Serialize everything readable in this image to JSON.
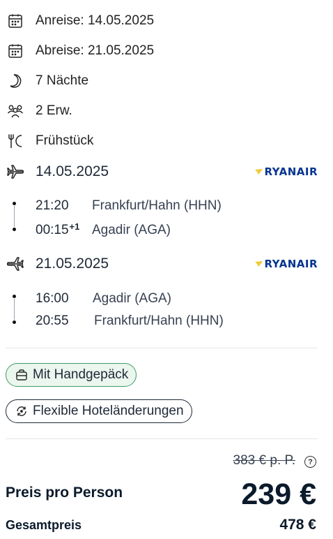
{
  "trip": {
    "arrival": "Anreise: 14.05.2025",
    "departure": "Abreise: 21.05.2025",
    "nights": "7 Nächte",
    "travelers": "2 Erw.",
    "board": "Frühstück"
  },
  "flights": {
    "outbound": {
      "date": "14.05.2025",
      "airline": "RYANAIR",
      "dep_time": "21:20",
      "dep_place": "Frankfurt/Hahn (HHN)",
      "arr_time": "00:15",
      "arr_day_offset": "+1",
      "arr_place": "Agadir (AGA)"
    },
    "return": {
      "date": "21.05.2025",
      "airline": "RYANAIR",
      "dep_time": "16:00",
      "dep_place": "Agadir (AGA)",
      "arr_time": "20:55",
      "arr_place": "Frankfurt/Hahn (HHN)"
    }
  },
  "features": {
    "hand_luggage": "Mit Handgepäck",
    "flexible_changes": "Flexible Hoteländerungen"
  },
  "pricing": {
    "old_price": "383 € p. P.",
    "help": "?",
    "price_label": "Preis pro Person",
    "price": "239 €",
    "total_label": "Gesamtpreis",
    "total": "478 €"
  },
  "colors": {
    "ryanair_blue": "#073590",
    "ryanair_yellow": "#f1c933",
    "chip_green_bg": "#eaf6ee",
    "chip_green_border": "#3f9a68"
  },
  "icons": {
    "arrival": "calendar-icon",
    "departure": "calendar-icon",
    "nights": "moon-icon",
    "travelers": "people-icon",
    "board": "fork-knife-icon",
    "outbound": "plane-departure-icon",
    "return": "plane-return-icon",
    "luggage": "luggage-icon",
    "flex": "refresh-icon"
  }
}
